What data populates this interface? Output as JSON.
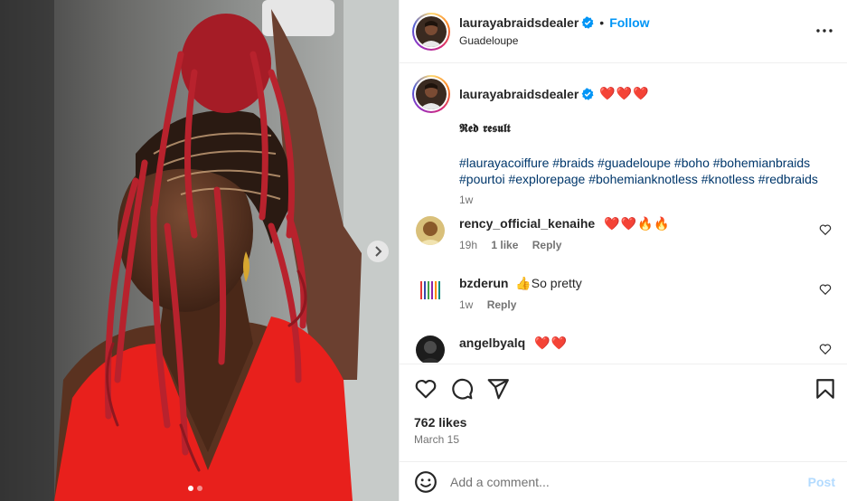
{
  "post": {
    "username": "laurayabraidsdealer",
    "verified": true,
    "follow_label": "Follow",
    "separator": "•",
    "location": "Guadeloupe",
    "media_count_dots": 2,
    "active_dot": 1
  },
  "caption": {
    "username": "laurayabraidsdealer",
    "emojis": "❤️❤️❤️",
    "title": "𝕽𝖊𝖉 𝖗𝖊𝖘𝖚𝖑𝖙",
    "hashtags_line1": "#laurayacoiffure #braids #guadeloupe #boho #bohemianbraids",
    "hashtags_line2": "#pourtoi #explorepage #bohemianknotless #knotless #redbraids",
    "time": "1w"
  },
  "comments": [
    {
      "username": "rency_official_kenaihe",
      "text": "❤️❤️🔥🔥",
      "time": "19h",
      "likes": "1 like",
      "reply": "Reply"
    },
    {
      "username": "bzderun",
      "text": "👍So pretty",
      "time": "1w",
      "likes": "",
      "reply": "Reply"
    },
    {
      "username": "angelbyalq",
      "text": "❤️❤️",
      "time": "",
      "likes": "",
      "reply": ""
    }
  ],
  "actions": {
    "icons": [
      "heart-icon",
      "comment-icon",
      "share-icon",
      "bookmark-icon"
    ],
    "likes": "762 likes",
    "date": "March 15"
  },
  "composer": {
    "placeholder": "Add a comment...",
    "post_label": "Post"
  },
  "colors": {
    "accent": "#0095f6",
    "link": "#00376b",
    "muted": "#737373",
    "post_disabled": "#b3dbff",
    "braid_red": "#b8222d"
  }
}
